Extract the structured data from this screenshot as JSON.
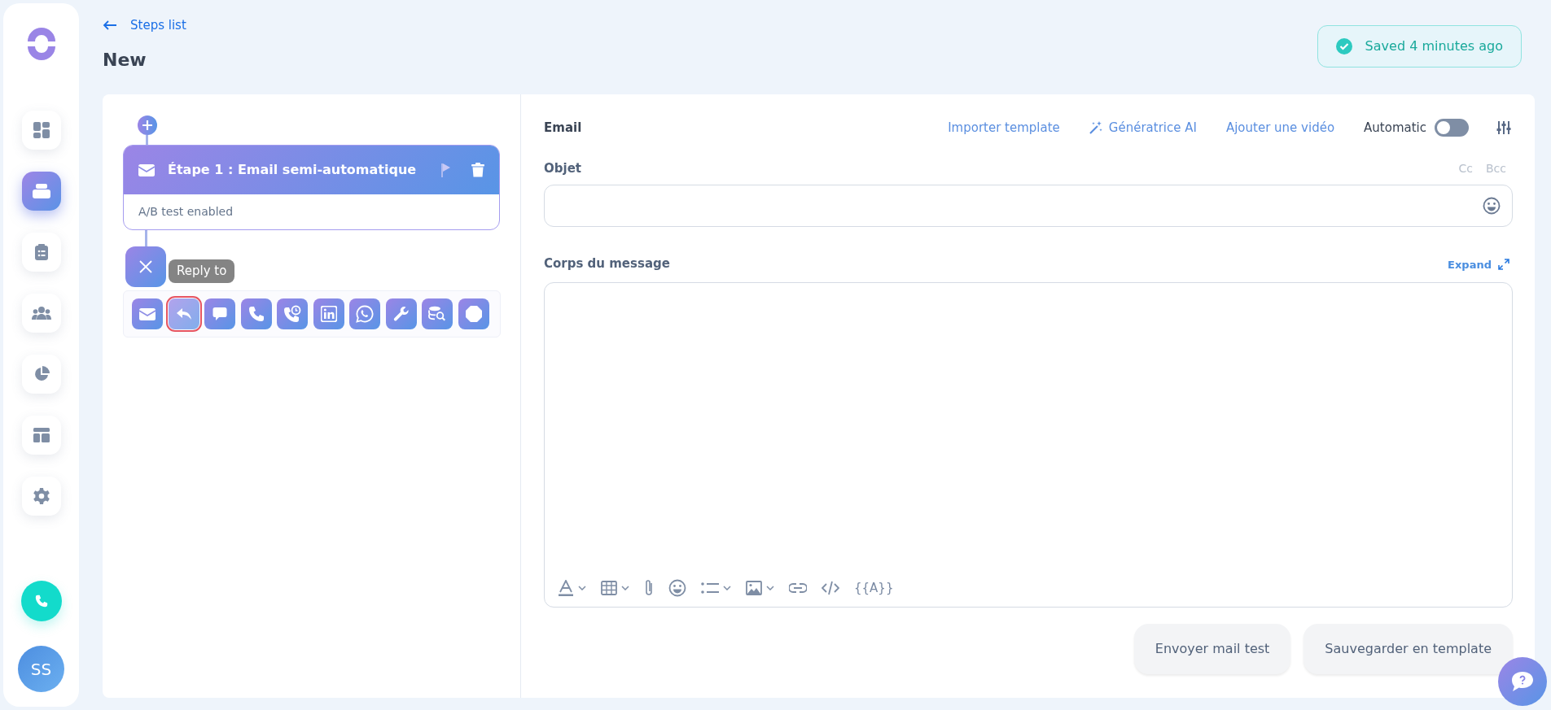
{
  "sidebar": {
    "items": [
      {
        "kind": "dashboard",
        "selected": false
      },
      {
        "kind": "inbox",
        "selected": true
      },
      {
        "kind": "clipboard",
        "selected": false
      },
      {
        "kind": "team",
        "selected": false
      },
      {
        "kind": "chart",
        "selected": false
      },
      {
        "kind": "layout",
        "selected": false
      },
      {
        "kind": "settings",
        "selected": false
      }
    ],
    "avatar": "SS"
  },
  "header": {
    "back_link": "Steps list",
    "title": "New",
    "save_status": "Saved 4 minutes ago"
  },
  "sequence": {
    "step": {
      "title": "Étape 1 : Email semi-automatique",
      "subtitle": "A/B test enabled"
    },
    "tooltip": "Reply to",
    "actions": [
      {
        "kind": "email",
        "selected": false
      },
      {
        "kind": "reply",
        "selected": true
      },
      {
        "kind": "chat",
        "selected": false
      },
      {
        "kind": "phone",
        "selected": false
      },
      {
        "kind": "phone-clock",
        "selected": false
      },
      {
        "kind": "linkedin",
        "selected": false
      },
      {
        "kind": "whatsapp",
        "selected": false
      },
      {
        "kind": "wrench",
        "selected": false
      },
      {
        "kind": "db-search",
        "selected": false
      },
      {
        "kind": "stop",
        "selected": false
      }
    ]
  },
  "editor": {
    "title": "Email",
    "links": [
      "Importer template",
      "Génératrice AI",
      "Ajouter une vidéo"
    ],
    "automatic": {
      "label": "Automatic",
      "on": false
    },
    "subject": {
      "label": "Objet",
      "cc": "Cc",
      "bcc": "Bcc"
    },
    "body": {
      "label": "Corps du message",
      "expand": "Expand"
    },
    "toolbar": [
      {
        "kind": "text-color",
        "menu": true
      },
      {
        "kind": "table",
        "menu": true
      },
      {
        "kind": "attach",
        "menu": false
      },
      {
        "kind": "emoji",
        "menu": false
      },
      {
        "kind": "list",
        "menu": true
      },
      {
        "kind": "image",
        "menu": true
      },
      {
        "kind": "link",
        "menu": false
      },
      {
        "kind": "code",
        "menu": false
      },
      {
        "kind": "variable",
        "text": "{{A}}"
      }
    ],
    "buttons": [
      "Envoyer mail test",
      "Sauvegarder en template"
    ]
  }
}
